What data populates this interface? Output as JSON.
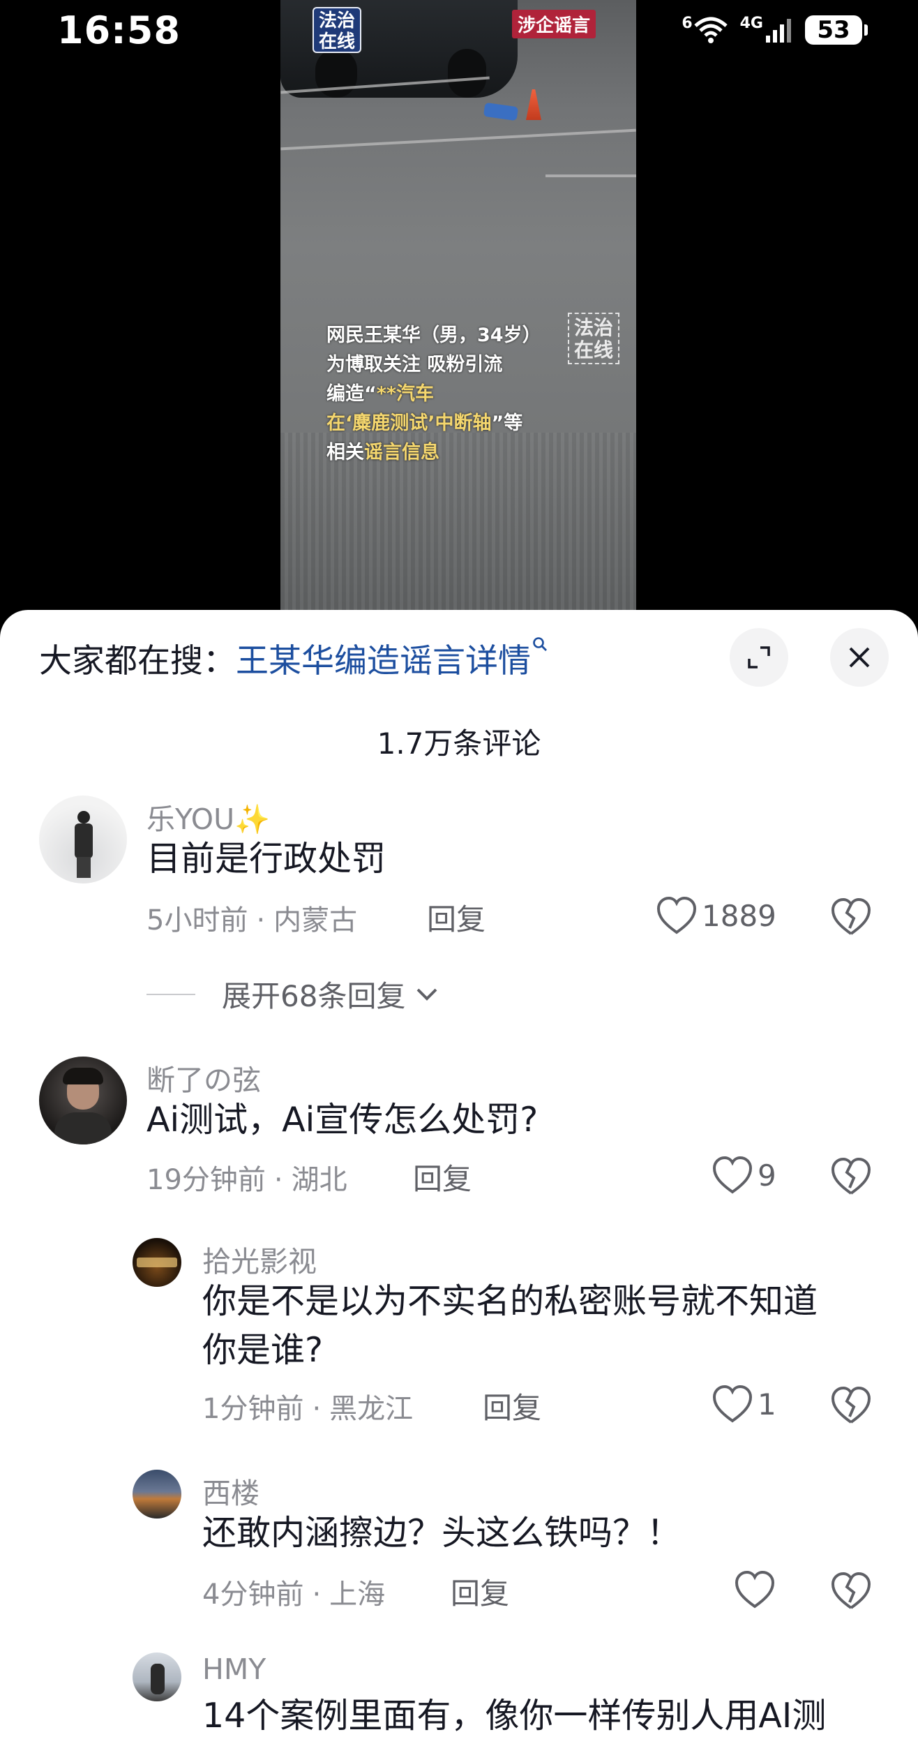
{
  "status_bar": {
    "time": "16:58",
    "wifi_label": "6",
    "network": "4G",
    "battery": "53"
  },
  "video": {
    "logo_text": "法治在线",
    "tag": "涉企谣言",
    "watermark": "法治在线",
    "caption": {
      "line1": "网民王某华（男，34岁）",
      "line2": "为博取关注 吸粉引流",
      "line3_pre": "编造“",
      "line3_hl": "**汽车",
      "line4_hl": "在‘麋鹿测试’中断轴",
      "line4_post": "”等",
      "line5_pre": "相关",
      "line5_hl": "谣言信息"
    }
  },
  "sheet": {
    "search_prefix": "大家都在搜：",
    "search_query": "王某华编造谣言详情",
    "comment_count": "1.7万条评论"
  },
  "comments": [
    {
      "user": "乐YOU✨",
      "text": "目前是行政处罚",
      "time": "5小时前",
      "location": "内蒙古",
      "reply": "回复",
      "likes": "1889",
      "expand": "展开68条回复"
    },
    {
      "user": "断了の弦",
      "text": "Ai测试，Ai宣传怎么处罚?",
      "time": "19分钟前",
      "location": "湖北",
      "reply": "回复",
      "likes": "9"
    },
    {
      "user": "拾光影视",
      "text_line1": "你是不是以为不实名的私密账号就不知道",
      "text_line2": "你是谁?",
      "time": "1分钟前",
      "location": "黑龙江",
      "reply": "回复",
      "likes": "1"
    },
    {
      "user": "西楼",
      "text": "还敢内涵擦边？头这么铁吗？！",
      "time": "4分钟前",
      "location": "上海",
      "reply": "回复",
      "likes": ""
    },
    {
      "user": "HMY",
      "text": "14个案例里面有，像你一样传别人用AI测"
    }
  ],
  "colors": {
    "link": "#1c4e9f",
    "muted": "#8a8b91",
    "text": "#161823",
    "video_tag": "#b0233a",
    "caption_highlight": "#f5d76e"
  }
}
